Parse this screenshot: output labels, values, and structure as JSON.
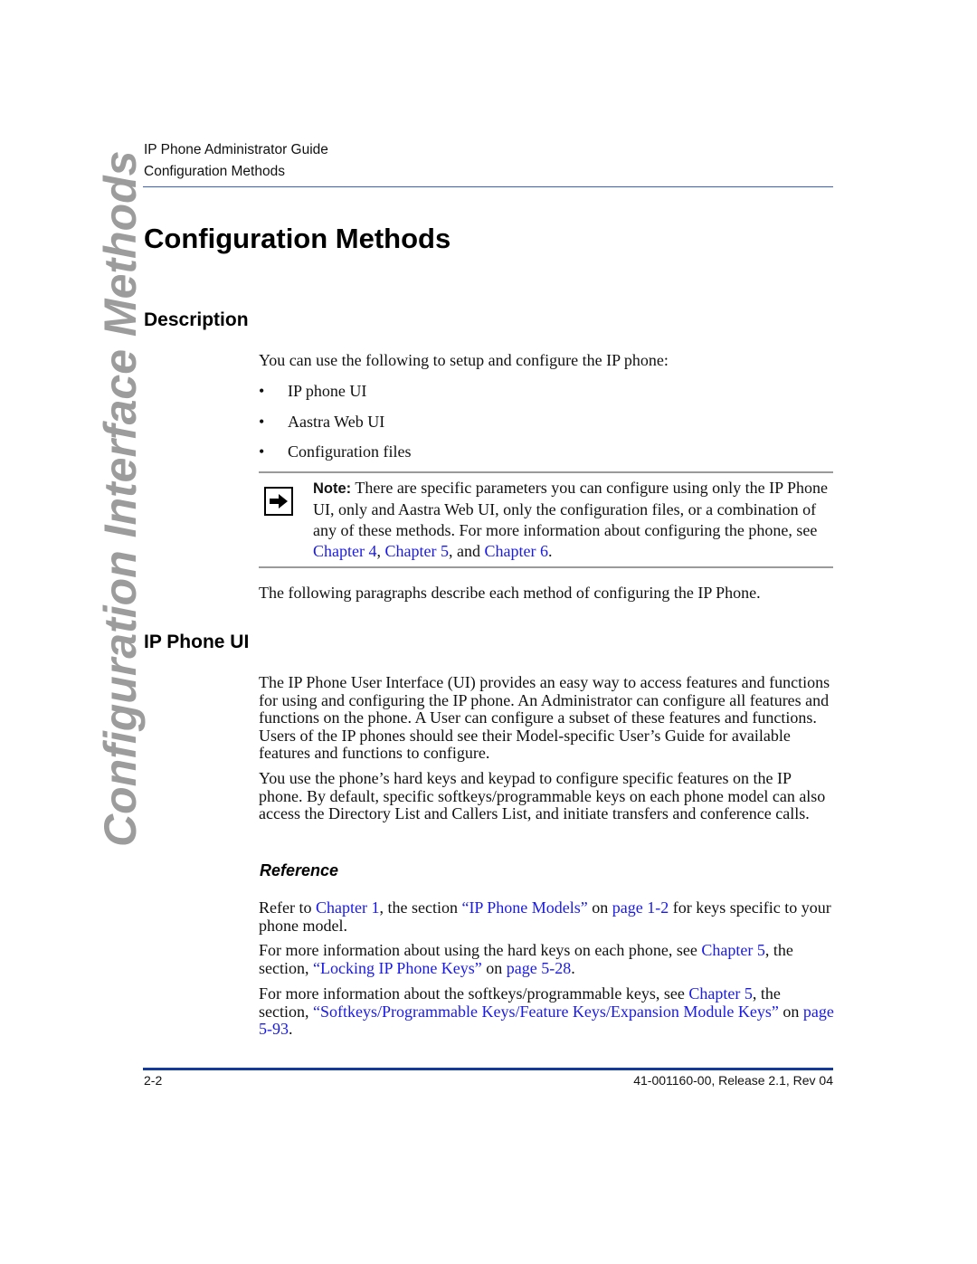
{
  "running_head": {
    "guide_title": "IP Phone Administrator Guide",
    "section": "Configuration Methods"
  },
  "side_tab": "Configuration Interface Methods",
  "page_title": "Configuration Methods",
  "description": {
    "heading": "Description",
    "intro": "You can use the following to setup and configure the IP phone:",
    "bullet_glyph": "•",
    "bullets": [
      "IP phone UI",
      "Aastra Web UI",
      "Configuration files"
    ],
    "note": {
      "icon": "arrow-right-icon",
      "label": "Note:",
      "text_1": " There are specific parameters you can configure using only the IP Phone UI, only and Aastra Web UI, only the configuration files, or a combination of any of these methods. For more information about configuring the phone, see ",
      "link_1": "Chapter 4",
      "sep_1": ", ",
      "link_2": "Chapter 5",
      "sep_2": ", and ",
      "link_3": "Chapter 6",
      "end": "."
    },
    "followup": "The following paragraphs describe each method of configuring the IP Phone."
  },
  "ip_phone_ui": {
    "heading": "IP Phone UI",
    "para_1": "The IP Phone User Interface (UI) provides an easy way to access features and functions for using and configuring the IP phone. An Administrator can configure all features and functions on the phone. A User can configure a subset of these features and functions. Users of the IP phones should see their Model-specific User’s Guide for available features and functions to configure.",
    "para_2": "You use the phone’s hard keys and keypad to configure specific features on the IP phone. By default, specific softkeys/programmable keys on each phone model can also access the Directory List and Callers List, and initiate transfers and conference calls."
  },
  "reference": {
    "heading": "Reference",
    "ref_1": {
      "t1": "Refer to ",
      "link_chapter": "Chapter 1",
      "t2": ", the section ",
      "link_section": "“IP Phone Models”",
      "t3": " on ",
      "link_page": "page 1-2",
      "t4": " for keys specific to your phone model."
    },
    "ref_2": {
      "t1": "For more information about using the hard keys on each phone, see ",
      "link_chapter": "Chapter 5",
      "t2": ", the section, ",
      "link_section": "“Locking IP Phone Keys”",
      "t3": " on ",
      "link_page": "page 5-28",
      "t4": "."
    },
    "ref_3": {
      "t1": "For more information about the softkeys/programmable keys, see ",
      "link_chapter": "Chapter 5",
      "t2": ", the section, ",
      "link_section": "“Softkeys/Programmable Keys/Feature Keys/Expansion Module Keys”",
      "t3": " on ",
      "link_page": "page 5-93",
      "t4": "."
    }
  },
  "footer": {
    "page_number": "2-2",
    "doc_id": "41-001160-00, Release 2.1, Rev 04"
  },
  "colors": {
    "link": "#1a1ae6",
    "header_rule": "#3a5fc4",
    "footer_rule": "#143a9c",
    "side_tab": "#9c9c9c"
  }
}
